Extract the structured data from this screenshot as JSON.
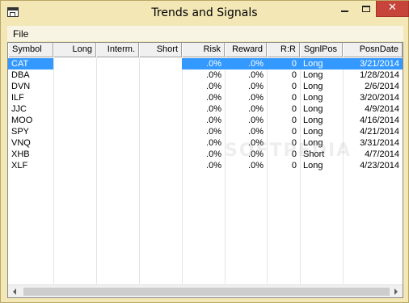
{
  "window": {
    "title": "Trends and Signals",
    "close_glyph": "✕"
  },
  "menu": {
    "items": [
      "File"
    ]
  },
  "grid": {
    "columns": [
      "Symbol",
      "Long",
      "Interm.",
      "Short",
      "Risk",
      "Reward",
      "R:R",
      "SgnlPos",
      "PosnDate"
    ],
    "rows": [
      {
        "symbol": "CAT",
        "long": "",
        "interm": "",
        "short": "",
        "risk": ".0%",
        "reward": ".0%",
        "rr": "0",
        "sgnlpos": "Long",
        "posndate": "3/21/2014",
        "selected": true
      },
      {
        "symbol": "DBA",
        "long": "",
        "interm": "",
        "short": "",
        "risk": ".0%",
        "reward": ".0%",
        "rr": "0",
        "sgnlpos": "Long",
        "posndate": "1/28/2014"
      },
      {
        "symbol": "DVN",
        "long": "",
        "interm": "",
        "short": "",
        "risk": ".0%",
        "reward": ".0%",
        "rr": "0",
        "sgnlpos": "Long",
        "posndate": "2/6/2014"
      },
      {
        "symbol": "ILF",
        "long": "",
        "interm": "",
        "short": "",
        "risk": ".0%",
        "reward": ".0%",
        "rr": "0",
        "sgnlpos": "Long",
        "posndate": "3/20/2014"
      },
      {
        "symbol": "JJC",
        "long": "",
        "interm": "",
        "short": "",
        "risk": ".0%",
        "reward": ".0%",
        "rr": "0",
        "sgnlpos": "Long",
        "posndate": "4/9/2014"
      },
      {
        "symbol": "MOO",
        "long": "",
        "interm": "",
        "short": "",
        "risk": ".0%",
        "reward": ".0%",
        "rr": "0",
        "sgnlpos": "Long",
        "posndate": "4/16/2014"
      },
      {
        "symbol": "SPY",
        "long": "",
        "interm": "",
        "short": "",
        "risk": ".0%",
        "reward": ".0%",
        "rr": "0",
        "sgnlpos": "Long",
        "posndate": "4/21/2014"
      },
      {
        "symbol": "VNQ",
        "long": "",
        "interm": "",
        "short": "",
        "risk": ".0%",
        "reward": ".0%",
        "rr": "0",
        "sgnlpos": "Long",
        "posndate": "3/31/2014"
      },
      {
        "symbol": "XHB",
        "long": "",
        "interm": "",
        "short": "",
        "risk": ".0%",
        "reward": ".0%",
        "rr": "0",
        "sgnlpos": "Short",
        "posndate": "4/7/2014"
      },
      {
        "symbol": "XLF",
        "long": "",
        "interm": "",
        "short": "",
        "risk": ".0%",
        "reward": ".0%",
        "rr": "0",
        "sgnlpos": "Long",
        "posndate": "4/23/2014"
      }
    ]
  },
  "watermark": "SOFTPEDIA",
  "colors": {
    "selection": "#3399ff",
    "frame": "#f3e7b6",
    "close": "#c7443a"
  }
}
